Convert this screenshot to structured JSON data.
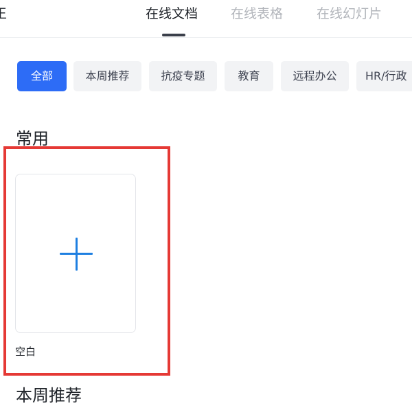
{
  "header": {
    "cut_glyph": "王",
    "tabs": [
      {
        "label": "在线文档",
        "active": true
      },
      {
        "label": "在线表格",
        "active": false
      },
      {
        "label": "在线幻灯片",
        "active": false
      }
    ]
  },
  "categories": [
    {
      "label": "全部",
      "active": true
    },
    {
      "label": "本周推荐",
      "active": false
    },
    {
      "label": "抗疫专题",
      "active": false
    },
    {
      "label": "教育",
      "active": false
    },
    {
      "label": "远程办公",
      "active": false
    },
    {
      "label": "HR/行政",
      "active": false
    }
  ],
  "sections": {
    "common": {
      "title": "常用",
      "items": [
        {
          "label": "空白",
          "icon": "plus-icon"
        }
      ]
    },
    "weekly": {
      "title": "本周推荐"
    }
  },
  "colors": {
    "accent": "#2d6cf6",
    "plus": "#1e7fe1",
    "highlight": "#e53935",
    "chip_bg": "#f2f3f5"
  }
}
